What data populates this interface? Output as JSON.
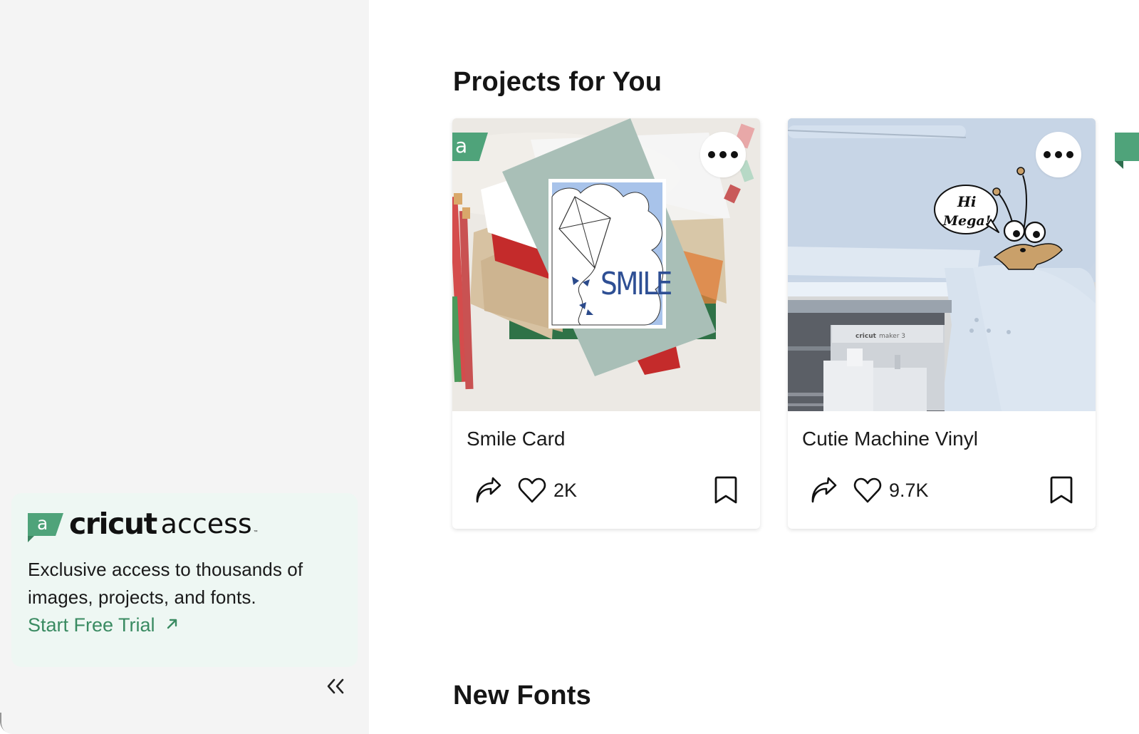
{
  "sidebar": {
    "promo": {
      "badge_letter": "a",
      "brand_primary": "cricut",
      "brand_secondary": "access",
      "trademark": "™",
      "description": "Exclusive access to thousands of images, projects, and fonts.",
      "cta_label": "Start Free Trial",
      "cta_icon": "arrow-up-right-icon"
    },
    "collapse_label": "«"
  },
  "main": {
    "sections": [
      {
        "title": "Projects for You"
      },
      {
        "title": "New Fonts"
      }
    ],
    "projects": [
      {
        "title": "Smile Card",
        "likes": "2K",
        "access_badge": "a",
        "image_alt": "Kite SMILE greeting card on paper stack"
      },
      {
        "title": "Cutie Machine Vinyl",
        "likes": "9.7K",
        "access_badge": null,
        "image_alt": "Cricut Maker 3 with Hi Mega! bug vinyl decal"
      }
    ],
    "peek_card": {
      "access_badge": "a"
    }
  },
  "colors": {
    "accent_green": "#4fa37a",
    "link_green": "#3a8b62",
    "sidebar_bg": "#f4f4f4",
    "promo_bg": "#eef7f3"
  }
}
